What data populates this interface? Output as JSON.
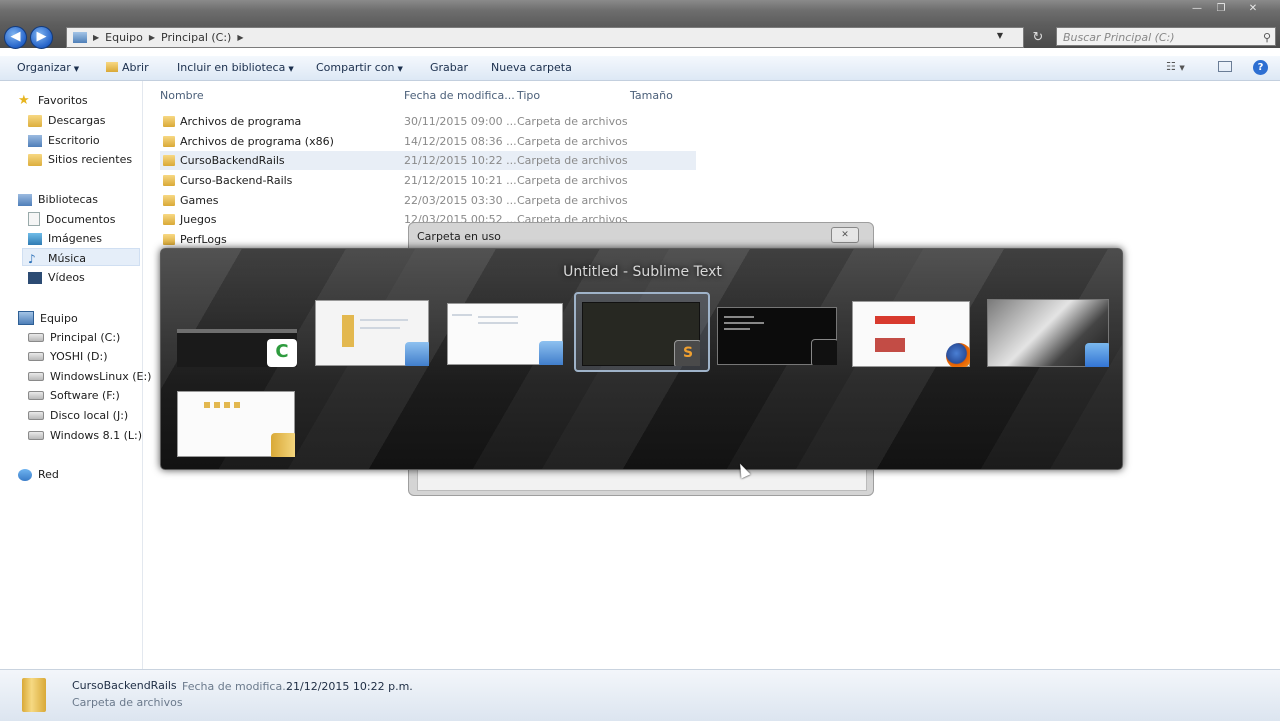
{
  "window": {
    "minimize_glyph": "—",
    "maximize_glyph": "❐",
    "close_glyph": "✕"
  },
  "address_bar": {
    "back_glyph": "◀",
    "forward_glyph": "▶",
    "crumbs": [
      "Equipo",
      "Principal (C:)"
    ],
    "refresh_glyph": "↻",
    "search_placeholder": "Buscar Principal (C:)"
  },
  "toolbar": {
    "organize": "Organizar",
    "open": "Abrir",
    "include_library": "Incluir en biblioteca",
    "share": "Compartir con",
    "burn": "Grabar",
    "new_folder": "Nueva carpeta",
    "help_glyph": "?"
  },
  "nav": {
    "favorites": "Favoritos",
    "downloads": "Descargas",
    "desktop": "Escritorio",
    "recent": "Sitios recientes",
    "libraries": "Bibliotecas",
    "documents": "Documentos",
    "images": "Imágenes",
    "music": "Música",
    "videos": "Vídeos",
    "computer": "Equipo",
    "drives": [
      "Principal (C:)",
      "YOSHI (D:)",
      "WindowsLinux (E:)",
      "Software (F:)",
      "Disco local (J:)",
      "Windows 8.1 (L:)"
    ],
    "network": "Red"
  },
  "columns": {
    "name": "Nombre",
    "date": "Fecha de modifica...",
    "type": "Tipo",
    "size": "Tamaño"
  },
  "files": [
    {
      "name": "Archivos de programa",
      "date": "30/11/2015 09:00 ...",
      "type": "Carpeta de archivos"
    },
    {
      "name": "Archivos de programa (x86)",
      "date": "14/12/2015 08:36 ...",
      "type": "Carpeta de archivos"
    },
    {
      "name": "CursoBackendRails",
      "date": "21/12/2015 10:22 ...",
      "type": "Carpeta de archivos"
    },
    {
      "name": "Curso-Backend-Rails",
      "date": "21/12/2015 10:21 ...",
      "type": "Carpeta de archivos"
    },
    {
      "name": "Games",
      "date": "22/03/2015 03:30 ...",
      "type": "Carpeta de archivos"
    },
    {
      "name": "Juegos",
      "date": "12/03/2015 00:52 ...",
      "type": "Carpeta de archivos"
    },
    {
      "name": "PerfLogs",
      "date": "",
      "type": ""
    }
  ],
  "dialog": {
    "title": "Carpeta en uso",
    "close_glyph": "✕"
  },
  "switcher": {
    "title": "Untitled - Sublime Text",
    "windows": [
      {
        "app_letter": "C",
        "app_color": "#2e9b3e"
      },
      {
        "app_letter": "",
        "app_color": "#5b8fd6"
      },
      {
        "app_letter": "",
        "app_color": "#5b8fd6"
      },
      {
        "app_letter": "S",
        "app_color": "#5a5a5a"
      },
      {
        "app_letter": "",
        "app_color": "#222222"
      },
      {
        "app_letter": "",
        "app_color": "#e66000"
      },
      {
        "app_letter": "",
        "app_color": "#3a78c8"
      },
      {
        "app_letter": "",
        "app_color": "#e0b040"
      }
    ]
  },
  "status": {
    "name": "CursoBackendRails",
    "date_label": "Fecha de modifica...",
    "date_value": "21/12/2015 10:22 p.m.",
    "type": "Carpeta de archivos"
  }
}
